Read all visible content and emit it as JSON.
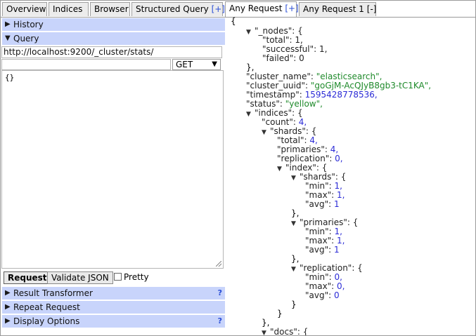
{
  "tabs": [
    {
      "label": "Overview"
    },
    {
      "label": "Indices"
    },
    {
      "label": "Browser"
    },
    {
      "label": "Structured Query",
      "action": "[+]"
    },
    {
      "label": "Any Request",
      "action": "[+]"
    },
    {
      "label": "Any Request 1",
      "action": "[-]"
    }
  ],
  "left": {
    "history_label": "History",
    "query_label": "Query",
    "url": "http://localhost:9200/_cluster/stats/",
    "path": "",
    "method": "GET",
    "body": "{}",
    "request_button": "Request",
    "validate_button": "Validate JSON",
    "pretty_label": "Pretty",
    "result_transformer": "Result Transformer",
    "repeat_request": "Repeat Request",
    "display_options": "Display Options",
    "help_mark": "?"
  },
  "json": {
    "open": "{",
    "nodes_key": "\"_nodes\": {",
    "total": "\"total\": 1,",
    "successful": "\"successful\": 1,",
    "failed": "\"failed\": 0",
    "close1": "},",
    "cluster_name_k": "\"cluster_name\": ",
    "cluster_name_v": "\"elasticsearch\",",
    "cluster_uuid_k": "\"cluster_uuid\": ",
    "cluster_uuid_v": "\"goGjM-AcQJyB8gb3-tC1KA\",",
    "timestamp_k": "\"timestamp\": ",
    "timestamp_v": "1595428778536,",
    "status_k": "\"status\": ",
    "status_v": "\"yellow\",",
    "indices_key": "\"indices\": {",
    "count_k": "\"count\": ",
    "count_v": "4,",
    "shards_key": "\"shards\": {",
    "stotal_k": "\"total\": ",
    "stotal_v": "4,",
    "primaries_k": "\"primaries\": ",
    "primaries_v": "4,",
    "replication_k": "\"replication\": ",
    "replication_v": "0,",
    "index_key": "\"index\": {",
    "ishards_key": "\"shards\": {",
    "min_k": "\"min\": ",
    "max_k": "\"max\": ",
    "avg_k": "\"avg\": ",
    "v1c": "1,",
    "v1": "1",
    "v0c": "0,",
    "v0": "0",
    "close_brace_comma": "},",
    "close_brace": "}",
    "iprimaries_key": "\"primaries\": {",
    "ireplication_key": "\"replication\": {",
    "docs_key": "\"docs\": {"
  }
}
